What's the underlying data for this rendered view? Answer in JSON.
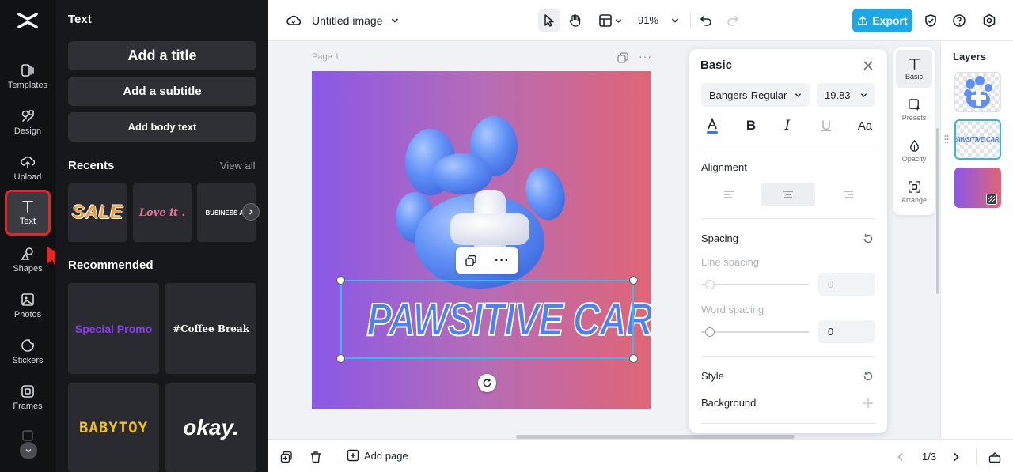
{
  "app": {
    "logo": "capcut-logo-icon"
  },
  "rail": {
    "items": [
      {
        "label": "Templates",
        "icon": "templates-icon"
      },
      {
        "label": "Design",
        "icon": "design-icon"
      },
      {
        "label": "Upload",
        "icon": "upload-icon"
      },
      {
        "label": "Text",
        "icon": "text-icon",
        "active": true
      },
      {
        "label": "Shapes",
        "icon": "shapes-icon"
      },
      {
        "label": "Photos",
        "icon": "photos-icon"
      },
      {
        "label": "Stickers",
        "icon": "stickers-icon"
      },
      {
        "label": "Frames",
        "icon": "frames-icon"
      }
    ]
  },
  "panel": {
    "title": "Text",
    "add_title": "Add a title",
    "add_subtitle": "Add a subtitle",
    "add_body": "Add body text",
    "recents_title": "Recents",
    "view_all": "View all",
    "recents": [
      "SALE",
      "Love it .",
      "BUSINESS AGENCY"
    ],
    "recommended_title": "Recommended",
    "recommended": [
      "Special Promo",
      "#Coffee Break",
      "BABYTOY",
      "okay."
    ]
  },
  "topbar": {
    "doc_title": "Untitled image",
    "zoom": "91%",
    "export_label": "Export"
  },
  "canvas": {
    "page_label": "Page 1",
    "text_content": "PAWSITIVE CARE"
  },
  "basic": {
    "title": "Basic",
    "font": "Bangers-Regular",
    "font_size": "19.83",
    "alignment_label": "Alignment",
    "spacing_label": "Spacing",
    "line_spacing_label": "Line spacing",
    "line_spacing_value": "0",
    "word_spacing_label": "Word spacing",
    "word_spacing_value": "0",
    "style_label": "Style",
    "background_label": "Background",
    "text_color": "#3a78e8"
  },
  "tabs": [
    {
      "label": "Basic",
      "active": true
    },
    {
      "label": "Presets"
    },
    {
      "label": "Opacity"
    },
    {
      "label": "Arrange"
    }
  ],
  "layers": {
    "title": "Layers",
    "thumb_text": "PAWSITIVE CARE"
  },
  "bottombar": {
    "add_page": "Add page",
    "pagination": "1/3"
  }
}
